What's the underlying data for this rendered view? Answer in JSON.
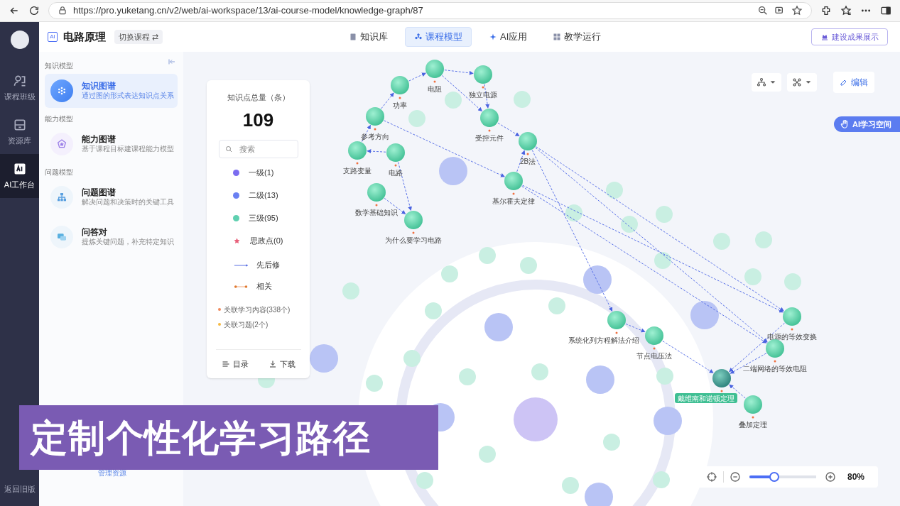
{
  "browser": {
    "url": "https://pro.yuketang.cn/v2/web/ai-workspace/13/ai-course-model/knowledge-graph/87"
  },
  "rail": {
    "items": [
      {
        "label": "课程班级",
        "kind": "class",
        "selected": false
      },
      {
        "label": "资源库",
        "kind": "library",
        "selected": false
      },
      {
        "label": "AI工作台",
        "kind": "ai",
        "selected": true
      }
    ],
    "footer": "返回旧版"
  },
  "header": {
    "badge": "AI",
    "course": "电路原理",
    "switch": "切换课程 ⇄",
    "tabs": [
      {
        "label": "知识库",
        "kind": "book",
        "selected": false
      },
      {
        "label": "课程模型",
        "kind": "model",
        "selected": true
      },
      {
        "label": "AI应用",
        "kind": "spark",
        "selected": false
      },
      {
        "label": "教学运行",
        "kind": "grid",
        "selected": false
      }
    ],
    "action": "建设成果展示"
  },
  "sidebar": {
    "sections": [
      {
        "title": "知识模型",
        "items": [
          {
            "title": "知识图谱",
            "subtitle": "通过图的形式表达知识点关系",
            "kind": "graph",
            "selected": true
          }
        ]
      },
      {
        "title": "能力模型",
        "items": [
          {
            "title": "能力图谱",
            "subtitle": "基于课程目标建课程能力模型",
            "kind": "star",
            "selected": false
          }
        ]
      },
      {
        "title": "问题模型",
        "items": [
          {
            "title": "问题图谱",
            "subtitle": "解决问题和决策时的关键工具",
            "kind": "tree",
            "selected": false
          },
          {
            "title": "问答对",
            "subtitle": "提炼关键问题，补充特定知识",
            "kind": "chat",
            "selected": false
          }
        ]
      }
    ],
    "link": "管理资源"
  },
  "legend": {
    "title": "知识点总量（条）",
    "total": "109",
    "search_placeholder": "搜索",
    "levels": [
      {
        "label": "一级(1)",
        "kind": "dot",
        "color": "#7b6cf0"
      },
      {
        "label": "二级(13)",
        "kind": "dot",
        "color": "#6a80f2"
      },
      {
        "label": "三级(95)",
        "kind": "dot",
        "color": "#5fd0b0"
      },
      {
        "label": "思政点(0)",
        "kind": "star",
        "color": "#e8607a"
      }
    ],
    "links": [
      {
        "label": "先后修",
        "kind": "arrow"
      },
      {
        "label": "相关",
        "kind": "dotted"
      }
    ],
    "stats": [
      {
        "label": "关联学习内容(338个)",
        "color": "#f08a5d"
      },
      {
        "label": "关联习题(2个)",
        "color": "#f5b942"
      }
    ],
    "buttons": [
      {
        "label": "目录",
        "kind": "list"
      },
      {
        "label": "下载",
        "kind": "download"
      }
    ]
  },
  "graph": {
    "nodes": [
      {
        "label": "电阻",
        "selected": false
      },
      {
        "label": "独立电源",
        "selected": false
      },
      {
        "label": "功率",
        "selected": false
      },
      {
        "label": "受控元件",
        "selected": false
      },
      {
        "label": "参考方向",
        "selected": false
      },
      {
        "label": "2B法",
        "selected": false
      },
      {
        "label": "支路变量",
        "selected": false
      },
      {
        "label": "电路",
        "selected": false
      },
      {
        "label": "基尔霍夫定律",
        "selected": false
      },
      {
        "label": "数学基础知识",
        "selected": false
      },
      {
        "label": "为什么要学习电路",
        "selected": false
      },
      {
        "label": "系统化列方程解法介绍",
        "selected": false
      },
      {
        "label": "节点电压法",
        "selected": false
      },
      {
        "label": "电源的等效变换",
        "selected": false
      },
      {
        "label": "二端网络的等效电阻",
        "selected": false
      },
      {
        "label": "戴维南和诺顿定理",
        "selected": true
      },
      {
        "label": "叠加定理",
        "selected": false
      }
    ],
    "edit": "编辑",
    "ai_space": "AI学习空间",
    "zoom": {
      "level": 0.35,
      "reading": "80%"
    }
  },
  "caption": "定制个性化学习路径"
}
